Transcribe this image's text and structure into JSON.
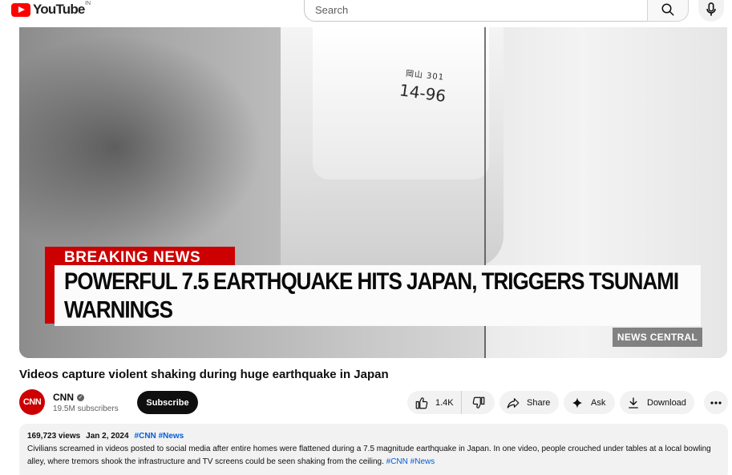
{
  "header": {
    "logo_text": "YouTube",
    "country_code": "IN",
    "search_placeholder": "Search"
  },
  "player": {
    "breaking_label": "BREAKING NEWS",
    "headline": "POWERFUL 7.5 EARTHQUAKE HITS JAPAN, TRIGGERS TSUNAMI WARNINGS",
    "network_tag": "NEWS CENTRAL",
    "plate_top": "岡山 301",
    "plate_number": "14-96"
  },
  "video": {
    "title": "Videos capture violent shaking during huge earthquake in Japan"
  },
  "channel": {
    "avatar_text": "CNN",
    "name": "CNN",
    "subscribers": "19.5M subscribers",
    "subscribe_label": "Subscribe"
  },
  "actions": {
    "like_count": "1.4K",
    "share_label": "Share",
    "ask_label": "Ask",
    "download_label": "Download"
  },
  "description": {
    "views": "169,723 views",
    "date": "Jan 2, 2024",
    "hashtags_top": [
      "#CNN",
      "#News"
    ],
    "text": "Civilians screamed in videos posted to social media after entire homes were flattened during a 7.5 magnitude earthquake in Japan. In one video, people crouched under tables at a local bowling alley, where tremors shook the infrastructure and TV screens could be seen shaking from the ceiling.",
    "hashtags_inline": [
      "#CNN",
      "#News"
    ]
  },
  "colors": {
    "brand_red": "#ff0000",
    "cnn_red": "#cc0000",
    "link_blue": "#065fd4",
    "chip_bg": "#f2f2f2"
  }
}
